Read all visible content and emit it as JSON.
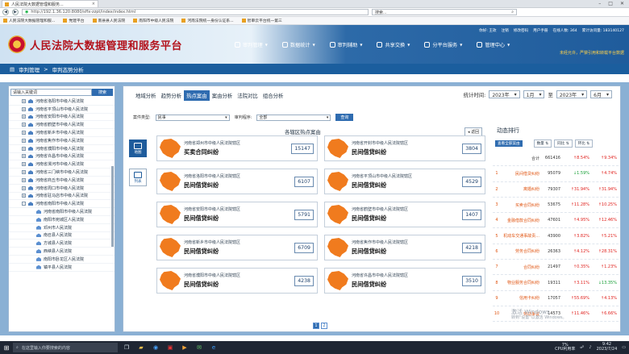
{
  "browser": {
    "tab_title": "人民法院大数据管理和服务...",
    "url": "http://192.1.36.120:8080/sffx-zzpt/index/index.html",
    "search_label": "搜索...",
    "favorites": [
      "人民法院大数据管理和服...",
      "党建平台",
      "南县县人民法院",
      "南阳市中级人民法院",
      "河南法院统一身份认证系...",
      "智审云平台统一第三"
    ]
  },
  "header": {
    "title": "人民法院大数据管理和服务平台",
    "user_line": [
      "你好: 王玫",
      "注销",
      "修改密码",
      "用户手册",
      "在线人数: 364",
      "累计访问量: 183140127"
    ],
    "nav": [
      {
        "label": "审判管理",
        "icon": "gavel-icon"
      },
      {
        "label": "数据统计",
        "icon": "chart-icon"
      },
      {
        "label": "审判辅助",
        "icon": "book-icon"
      },
      {
        "label": "共享交换",
        "icon": "share-icon"
      },
      {
        "label": "分平台服务",
        "icon": "network-icon"
      },
      {
        "label": "管理中心",
        "icon": "gear-icon"
      }
    ],
    "slogan": "未经允许，严禁引用和转载平台数据"
  },
  "breadcrumb": {
    "root": "审判管理",
    "sep": ">",
    "current": "审判态势分析"
  },
  "sidebar": {
    "search_placeholder": "请输入关键词",
    "search_btn": "搜索",
    "items": [
      {
        "label": "河南省洛阳市中级人民法院",
        "mark": "+"
      },
      {
        "label": "河南省平顶山市中级人民法院",
        "mark": "+"
      },
      {
        "label": "河南省安阳市中级人民法院",
        "mark": "+"
      },
      {
        "label": "河南省鹤壁市中级人民法院",
        "mark": "+"
      },
      {
        "label": "河南省新乡市中级人民法院",
        "mark": "+"
      },
      {
        "label": "河南省焦作市中级人民法院",
        "mark": "+"
      },
      {
        "label": "河南省濮阳市中级人民法院",
        "mark": "+"
      },
      {
        "label": "河南省许昌市中级人民法院",
        "mark": "+"
      },
      {
        "label": "河南省漯河市中级人民法院",
        "mark": "+"
      },
      {
        "label": "河南省三门峡市中级人民法院",
        "mark": "+"
      },
      {
        "label": "河南省商丘市中级人民法院",
        "mark": "+"
      },
      {
        "label": "河南省周口市中级人民法院",
        "mark": "+"
      },
      {
        "label": "河南省驻马店市中级人民法院",
        "mark": "+"
      },
      {
        "label": "河南省南阳市中级人民法院",
        "mark": "-"
      }
    ],
    "sub_items": [
      "河南省南阳市中级人民法院",
      "南阳市宛城区人民法院",
      "邓州市人民法院",
      "南召县人民法院",
      "方城县人民法院",
      "西峡县人民法院",
      "南阳市卧龙区人民法院",
      "镇平县人民法院"
    ]
  },
  "content": {
    "tabs": [
      "地域分析",
      "趋势分析",
      "热点案由",
      "案由分析",
      "法院对比",
      "组合分析"
    ],
    "active_tab": "热点案由",
    "time": {
      "label": "统计时间:",
      "y1": "2023年",
      "m1": "1月",
      "to": "至",
      "y2": "2023年",
      "m2": "6月"
    },
    "filters": {
      "type_label": "案件类型:",
      "type_value": "民事",
      "proc_label": "审判程序:",
      "proc_value": "全部",
      "query_btn": "查询"
    },
    "hot_title": "各辖区热点案由",
    "back_btn": "返回",
    "view_icons": [
      {
        "label": "地图",
        "icon": "map-view-icon"
      },
      {
        "label": "列表",
        "icon": "list-view-icon"
      }
    ],
    "cards": [
      {
        "region": "河南省郑州市中级人民法院辖区",
        "case": "买卖合同纠纷",
        "count": "15147"
      },
      {
        "region": "河南省开封市中级人民法院辖区",
        "case": "民间借贷纠纷",
        "count": "3804"
      },
      {
        "region": "河南省洛阳市中级人民法院辖区",
        "case": "民间借贷纠纷",
        "count": "6107"
      },
      {
        "region": "河南省平顶山市中级人民法院辖区",
        "case": "民间借贷纠纷",
        "count": "4529"
      },
      {
        "region": "河南省安阳市中级人民法院辖区",
        "case": "民间借贷纠纷",
        "count": "5791"
      },
      {
        "region": "河南省鹤壁市中级人民法院辖区",
        "case": "民间借贷纠纷",
        "count": "1407"
      },
      {
        "region": "河南省新乡市中级人民法院辖区",
        "case": "民间借贷纠纷",
        "count": "6709"
      },
      {
        "region": "河南省焦作市中级人民法院辖区",
        "case": "民间借贷纠纷",
        "count": "4218"
      },
      {
        "region": "河南省濮阳市中级人民法院辖区",
        "case": "民间借贷纠纷",
        "count": "4238"
      },
      {
        "region": "河南省许昌市中级人民法院辖区",
        "case": "民间借贷纠纷",
        "count": "3510"
      }
    ],
    "pages": [
      "1",
      "2"
    ],
    "current_page": "1",
    "ranking": {
      "title": "动态排行",
      "btn": "查看全部案由",
      "headers": [
        "数量",
        "同比",
        "环比"
      ],
      "rows": [
        {
          "rank": "",
          "name": "合计",
          "count": "661416",
          "yoy": "↑8.54%",
          "mom": "↑9.34%",
          "yoy_dir": "up",
          "mom_dir": "up"
        },
        {
          "rank": "1",
          "name": "民间借贷纠纷",
          "count": "95079",
          "yoy": "↓1.59%",
          "mom": "↑4.74%",
          "yoy_dir": "dn",
          "mom_dir": "up"
        },
        {
          "rank": "2",
          "name": "离婚纠纷",
          "count": "79307",
          "yoy": "↑31.94%",
          "mom": "↑31.94%",
          "yoy_dir": "up",
          "mom_dir": "up"
        },
        {
          "rank": "3",
          "name": "买卖合同纠纷",
          "count": "53675",
          "yoy": "↑11.28%",
          "mom": "↑10.25%",
          "yoy_dir": "up",
          "mom_dir": "up"
        },
        {
          "rank": "4",
          "name": "金融借款合同纠纷",
          "count": "47601",
          "yoy": "↑4.95%",
          "mom": "↑12.46%",
          "yoy_dir": "up",
          "mom_dir": "up"
        },
        {
          "rank": "5",
          "name": "机动车交通事故责...",
          "count": "43900",
          "yoy": "↑3.82%",
          "mom": "↑5.21%",
          "yoy_dir": "up",
          "mom_dir": "up"
        },
        {
          "rank": "6",
          "name": "劳务合同纠纷",
          "count": "26363",
          "yoy": "↑4.12%",
          "mom": "↑28.31%",
          "yoy_dir": "up",
          "mom_dir": "up"
        },
        {
          "rank": "7",
          "name": "合同纠纷",
          "count": "21497",
          "yoy": "↑0.35%",
          "mom": "↑1.23%",
          "yoy_dir": "up",
          "mom_dir": "up"
        },
        {
          "rank": "8",
          "name": "物业服务合同纠纷",
          "count": "19311",
          "yoy": "↑3.11%",
          "mom": "↓13.35%",
          "yoy_dir": "up",
          "mom_dir": "dn"
        },
        {
          "rank": "9",
          "name": "信用卡纠纷",
          "count": "17057",
          "yoy": "↑55.69%",
          "mom": "↑4.13%",
          "yoy_dir": "up",
          "mom_dir": "up"
        },
        {
          "rank": "10",
          "name": "劳动争议",
          "count": "14573",
          "yoy": "↑11.46%",
          "mom": "↑6.66%",
          "yoy_dir": "up",
          "mom_dir": "up"
        }
      ]
    }
  },
  "watermark": {
    "line1": "激活 Windows",
    "line2": "转到\"设置\"以激活 Windows。"
  },
  "taskbar": {
    "search_placeholder": "在这里输入你要搜索的内容",
    "cpu_value": "7%",
    "cpu_label": "CPU利用率",
    "time": "9:42",
    "date": "2023/7/24"
  },
  "colors": {
    "accent": "#2f6cb0",
    "title_red": "#b3121b",
    "region_orange": "#f07b1e",
    "up": "#e0221e",
    "down": "#19a038"
  }
}
